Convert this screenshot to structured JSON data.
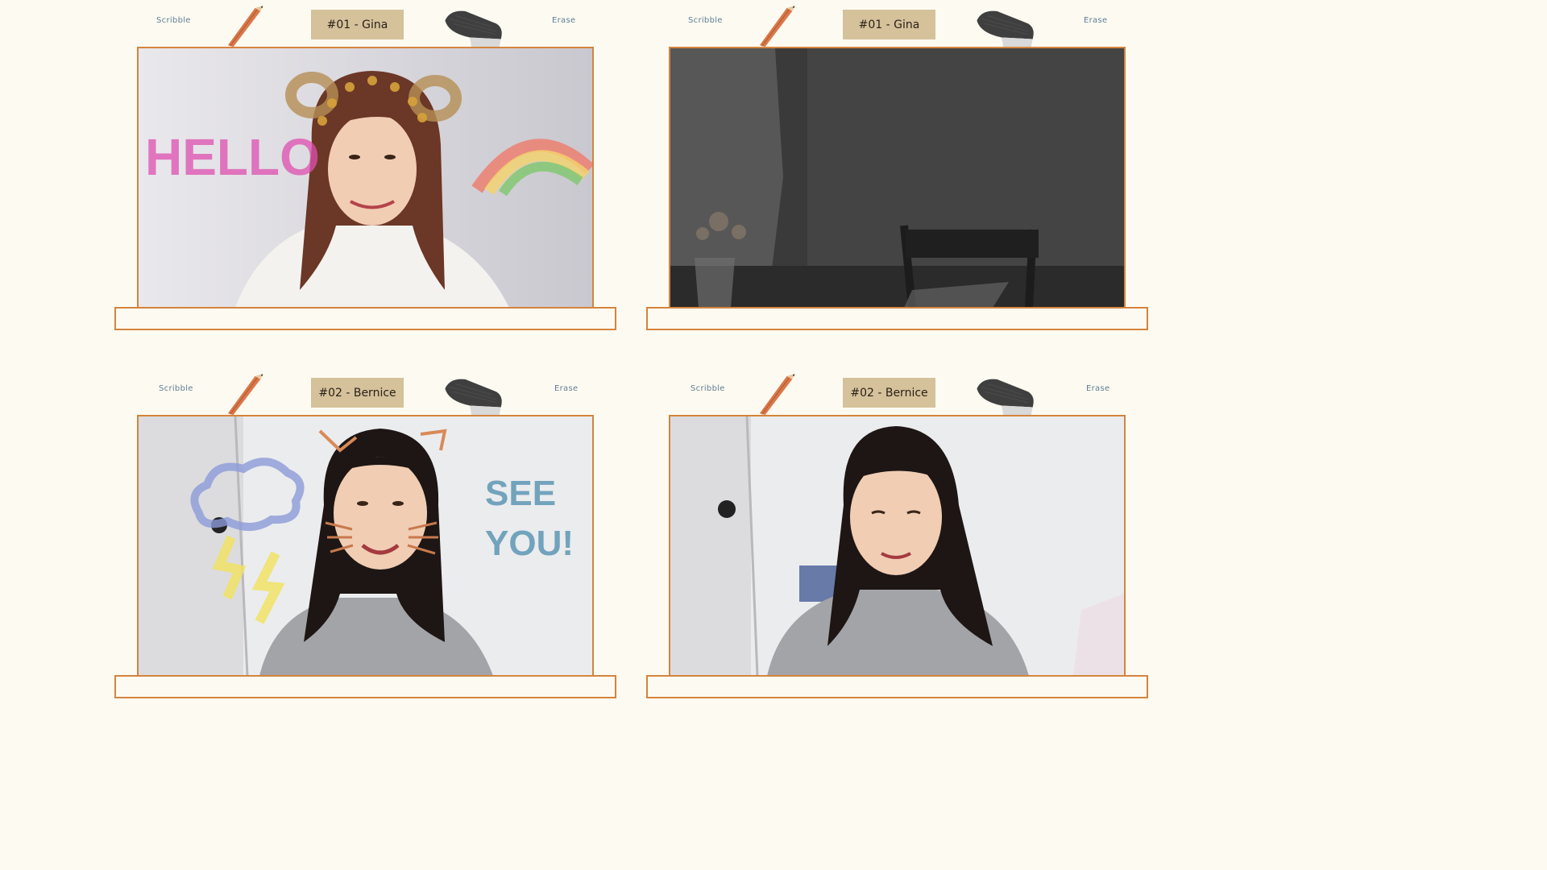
{
  "panels": [
    {
      "scribble_label": "Scribble",
      "erase_label": "Erase",
      "name_tag": "#01 - Gina",
      "drawn_text": "HELLO",
      "caption": ""
    },
    {
      "scribble_label": "Scribble",
      "erase_label": "Erase",
      "name_tag": "#01 - Gina",
      "drawn_text": "",
      "caption": ""
    },
    {
      "scribble_label": "Scribble",
      "erase_label": "Erase",
      "name_tag": "#02 - Bernice",
      "drawn_text": "SEE YOU!",
      "caption": ""
    },
    {
      "scribble_label": "Scribble",
      "erase_label": "Erase",
      "name_tag": "#02 - Bernice",
      "drawn_text": "",
      "caption": ""
    }
  ],
  "colors": {
    "accent": "#d4843e",
    "tag": "#d5c19a",
    "background": "#fdfbf1",
    "control_text": "#5f7d98"
  },
  "icons": [
    "pencil-icon",
    "eraser-icon"
  ]
}
